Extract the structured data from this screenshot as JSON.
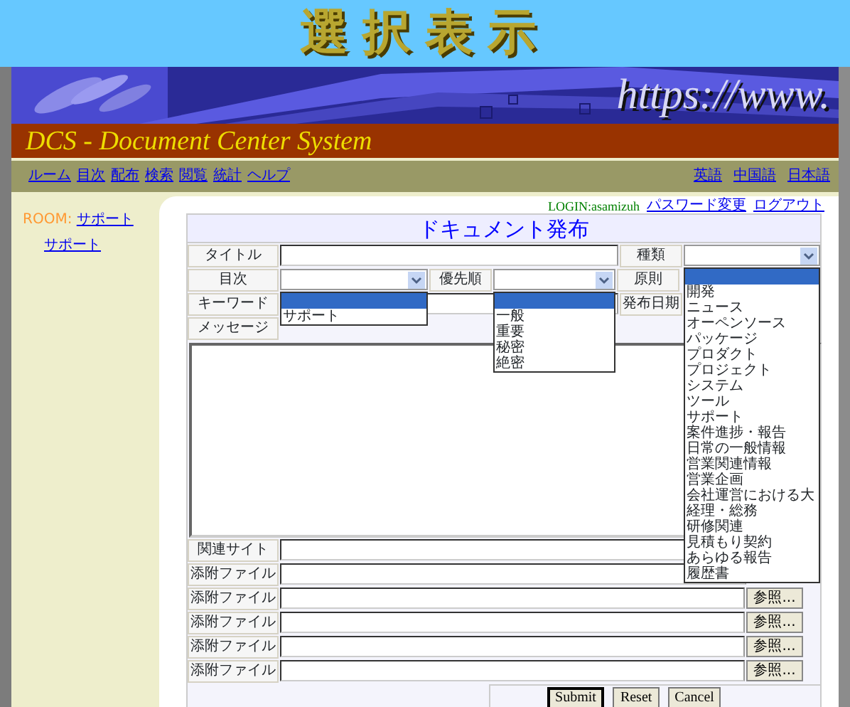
{
  "page_title": "選択表示",
  "banner": {
    "url_text": "https://www."
  },
  "system_title": "DCS - Document Center System",
  "nav": {
    "left": [
      "ルーム",
      "目次",
      "配布",
      "検索",
      "閲覧",
      "統計",
      "ヘルプ"
    ],
    "right": [
      "英語",
      "中国語",
      "日本語"
    ]
  },
  "sidebar": {
    "room_label": "ROOM:",
    "room_link": "サポート",
    "items": [
      "サポート"
    ]
  },
  "login": {
    "user": "LOGIN:asamizuh",
    "links": [
      "パスワード変更",
      "ログアウト"
    ]
  },
  "form": {
    "title": "ドキュメント発布",
    "labels": {
      "title": "タイトル",
      "type": "種類",
      "toc": "目次",
      "priority": "優先順",
      "principle": "原則",
      "keyword": "キーワード",
      "date": "発布日期",
      "message": "メッセージ",
      "site": "関連サイト"
    },
    "toc_dropdown": {
      "open": true,
      "blank_highlighted": true,
      "options": [
        "サポート"
      ]
    },
    "priority_dropdown": {
      "open": true,
      "blank_highlighted": true,
      "options": [
        "一般",
        "重要",
        "秘密",
        "絶密"
      ]
    },
    "type_dropdown": {
      "open": true,
      "blank_highlighted": true,
      "options": [
        "開発",
        "ニュース",
        "オーペンソース",
        "パッケージ",
        "プロダクト",
        "プロジェクト",
        "システム",
        "ツール",
        "サポート",
        "案件進捗・報告",
        "日常の一般情報",
        "営業関連情報",
        "営業企画",
        "会社運営における大",
        "経理・総務",
        "研修関連",
        "見積もり契約",
        "あらゆる報告",
        "履歴書"
      ]
    },
    "attachments": [
      {
        "label": "添附ファイル"
      },
      {
        "label": "添附ファイル",
        "browse": "参照..."
      },
      {
        "label": "添附ファイル",
        "browse": "参照..."
      },
      {
        "label": "添附ファイル",
        "browse": "参照..."
      },
      {
        "label": "添附ファイル",
        "browse": "参照..."
      }
    ],
    "buttons": [
      {
        "label": "Submit",
        "default": true
      },
      {
        "label": "Reset",
        "default": false
      },
      {
        "label": "Cancel",
        "default": false
      }
    ]
  }
}
